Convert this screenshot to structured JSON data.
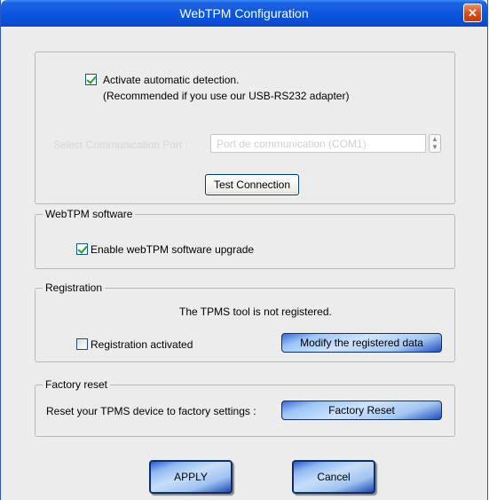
{
  "window": {
    "title": "WebTPM Configuration",
    "close_label": "✕"
  },
  "detection": {
    "activate_label": "Activate automatic detection.",
    "activate_checked": true,
    "recommendation": "(Recommended if you use our USB-RS232 adapter)",
    "port_label": "Select Communication Port :",
    "port_value": "Port de communication (COM1)",
    "test_button": "Test Connection"
  },
  "software": {
    "legend": "WebTPM software",
    "upgrade_label": "Enable webTPM software upgrade",
    "upgrade_checked": true
  },
  "registration": {
    "legend": "Registration",
    "status": "The TPMS tool is not registered.",
    "activated_label": "Registration activated",
    "activated_checked": false,
    "modify_button": "Modify the registered data"
  },
  "factory": {
    "legend": "Factory reset",
    "description": "Reset your TPMS device to factory settings :",
    "reset_button": "Factory Reset"
  },
  "actions": {
    "apply": "APPLY",
    "cancel": "Cancel"
  },
  "colors": {
    "titlebar": "#0a55e0",
    "window_bg": "#ececec",
    "button_blue": "#cfe3fb"
  }
}
